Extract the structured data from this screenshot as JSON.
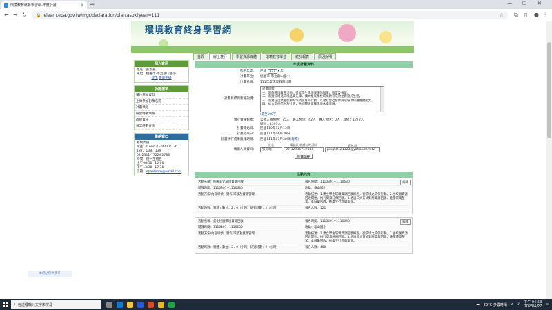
{
  "browser": {
    "tab_title": "環境教育終身學習網-年度計畫…",
    "url": "elearn.epa.gov.tw/mgr/declaration/plan.aspx?year=111"
  },
  "site": {
    "title": "環境教育終身學習網",
    "tabs": [
      "首頁",
      "線上遵行",
      "學習資源媒體",
      "環境教育單位",
      "統計報表",
      "原因說明"
    ]
  },
  "left": {
    "user_header": "個人資訊",
    "user_name": "姓名：張淑嘉",
    "user_unit": "單位：桃園市-市立龜山國小",
    "logout": "登出",
    "change_pw": "更新密碼",
    "func_header": "功能選項",
    "menu": [
      "單位基本資料",
      "上傳參加影像名冊",
      "計畫填報",
      "研習時數填報",
      "辦教資訊",
      "員工時數查詢"
    ],
    "contact_header": "聯絡窗口",
    "contact": {
      "title": "系統問題",
      "phone1": "電話：02-6630-0668#136、137、138、139",
      "phone2": "02-2311-7722#2788",
      "time_label": "時間：週一至週五",
      "time1": "上午08:30~12:00",
      "time2": "下午13:30~17:30",
      "email_label": "信箱：",
      "email": "epaelearn@email.com"
    }
  },
  "form": {
    "header": "年度計畫資料",
    "year_label": "適用年度：",
    "year_value": "111",
    "year_suffix": "年",
    "unit_label": "計畫單位：",
    "unit_value": "桃園市-市立龜山國小",
    "name_label": "計畫名稱：",
    "name_value": "111年度環境教育計畫",
    "goal_label": "計畫目標與策略說明：",
    "goal_lines": [
      "計畫目標：",
      "一、實施環境教育活動，提昇學生環境保護的知識、態度及技能。",
      "二、落實於增進環境品質先鋒，擴大推展學校環境教育成效並實施於生活，",
      "三、落實在自然生態中對環境保育的行動，以達結合社會參與及環境保護實體能力。",
      "四、結合學校學生及社區，共同關懷保護環境永續發展。"
    ],
    "goal_note": "(最至500字)",
    "expected_label": "預計實施對象：",
    "expected_value": "公教人員預估：75人　員工預估：42人　專人預估：0人　其他：1272人",
    "total_value": "總計：1393人",
    "start_label": "計畫開始日：",
    "start_value": "民國110年12月15日",
    "end_label": "計畫結束日：",
    "end_value": "民國111年06月30日",
    "deadline_label": "計畫執行成果繳報期限：",
    "deadline_value": "民國111年07月30日",
    "deadline_note": "(報成)",
    "contact_label": "填報人員資料：",
    "col_name": "姓名",
    "col_phone": "電話(分機請以#分隔)",
    "col_email": "E-Mail",
    "contact_name": "張昂竑",
    "contact_phone": "03-3293571#310",
    "contact_email": "ping58121123@yahoo.com.tw",
    "save": "計畫儲存"
  },
  "activities": {
    "header": "活動內容",
    "edit": "編輯",
    "items": [
      {
        "name": "活動名稱：校園美化環境資源回收",
        "signup": "報名時間：1110301~1110630",
        "period": "開課時間：1110301~1110630",
        "place": "地點：龜山國小",
        "method": "活動方法/內容導領：實作/環境及資源管理",
        "desc": "活動描述：1.建立學生環境資源回收概念，從環境之環保行動。2.由校園資源回收開始，推行資源分類回收。3.透過三大方式對應資源回收、維護環境整潔。4.鼓勵回收，推廣至社區與家庭。",
        "hours": "活動時數：實體 / 數位：2 / 0（小時）研究時數：2（小時）",
        "count": "報名人數：121"
      },
      {
        "name": "活動名稱：美化校園環境資源回收",
        "signup": "報名時間：1110401~1110630",
        "period": "開課時間：1110401~1110630",
        "place": "地點：龜山國小",
        "method": "活動方法/內容導領：實作/環境及資源管理",
        "desc": "活動描述：1.建立學生環境資源回收概念，從環境之環保行動。2.由校園資源回收開始，推行資源分類回收。3.透過三大方式對應資源回收、維護環境整潔。4.鼓勵回收，推廣至社區與家庭。",
        "hours": "活動時數：實體 / 數位：2 / 0（小時）研究時數：2（小時）",
        "count": "報名人數：400"
      }
    ]
  },
  "taskbar": {
    "search_placeholder": "在這裡輸入文字來搜尋",
    "weather": "25°C 多雲時晴",
    "time": "下午 04:53",
    "date": "2023/4/27"
  },
  "watermark": "本網站僅供參考"
}
